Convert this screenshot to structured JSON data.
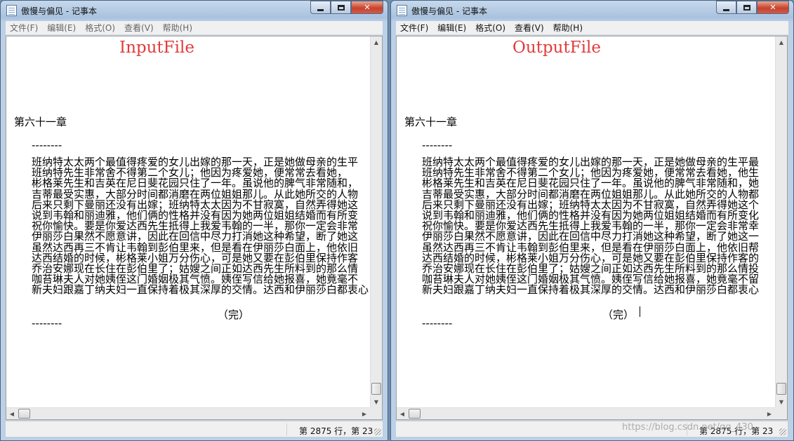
{
  "windows": {
    "left": {
      "title": "傲慢与偏见 - 记事本",
      "menu": [
        "文件(F)",
        "编辑(E)",
        "格式(O)",
        "查看(V)",
        "帮助(H)"
      ],
      "overlay_label": "InputFile",
      "content": {
        "chapter": "第六十一章",
        "rule_top": "--------",
        "paragraph": [
          "班纳特太太两个最值得疼爱的女儿出嫁的那一天，正是她做母亲的生平",
          "班纳特先生非常舍不得第二个女儿；他因为疼爱她，便常常去看她，",
          "彬格莱先生和吉英在尼日斐花园只住了一年。虽说他的脾气非常随和，",
          "吉蒂最受实惠，大部分时间都消磨在两位姐姐那儿。从此她所交的人物",
          "后来只剩下曼丽还没有出嫁；班纳特太太因为不甘寂寞，自然弄得她这",
          "说到韦翰和丽迪雅，他们俩的性格并没有因为她两位姐姐结婚而有所变",
          "祝你愉快。要是你爱达西先生抵得上我爱韦翰的一半，那你一定会非常",
          "伊丽莎白果然不愿意讲，因此在回信中尽力打消她这种希望，断了她这",
          "虽然达西再三不肯让韦翰到彭伯里来，但是看在伊丽莎白面上，他依旧",
          "达西结婚的时候，彬格莱小姐万分伤心，可是她又要在彭伯里保持作客",
          "乔治安娜现在长住在彭伯里了；姑嫂之间正如达西先生所料到的那么情",
          "咖苔琳夫人对她姨侄这门婚姻极其气愤。姨侄写信给她报喜，她竟毫不",
          "新夫妇跟嘉丁纳夫妇一直保持着极其深厚的交情。达西和伊丽莎白都衷心"
        ],
        "end_mark": "（完）",
        "rule_bottom": "--------"
      },
      "status": "第 2875 行，第 23"
    },
    "right": {
      "title": "傲慢与偏见 - 记事本",
      "menu": [
        "文件(F)",
        "编辑(E)",
        "格式(O)",
        "查看(V)",
        "帮助(H)"
      ],
      "overlay_label": "OutputFile",
      "content": {
        "chapter": "第六十一章",
        "rule_top": "--------",
        "paragraph": [
          "班纳特太太两个最值得疼爱的女儿出嫁的那一天，正是她做母亲的生平最",
          "班纳特先生非常舍不得第二个女儿；他因为疼爱她，便常常去看她，他生",
          "彬格莱先生和吉英在尼日斐花园只住了一年。虽说他的脾气非常随和，她",
          "吉蒂最受实惠，大部分时间都消磨在两位姐姐那儿。从此她所交的人物都",
          "后来只剩下曼丽还没有出嫁；班纳特太太因为不甘寂寞，自然弄得她这个",
          "说到韦翰和丽迪雅，他们俩的性格并没有因为她两位姐姐结婚而有所变化",
          "祝你愉快。要是你爱达西先生抵得上我爱韦翰的一半，那你一定会非常幸",
          "伊丽莎白果然不愿意讲，因此在回信中尽力打消她这种希望，断了她这一",
          "虽然达西再三不肯让韦翰到彭伯里来，但是看在伊丽莎白面上，他依旧帮",
          "达西结婚的时候，彬格莱小姐万分伤心，可是她又要在彭伯里保持作客的",
          "乔治安娜现在长住在彭伯里了；姑嫂之间正如达西先生所料到的那么情投",
          "咖苔琳夫人对她姨侄这门婚姻极其气愤。姨侄写信给她报喜，她竟毫不留",
          "新夫妇跟嘉丁纳夫妇一直保持着极其深厚的交情。达西和伊丽莎白都衷心"
        ],
        "end_mark": "（完）",
        "rule_bottom": "--------"
      },
      "status": "第 2875 行，第 23"
    }
  },
  "watermark": "https://blog.csdn.net/qq_430",
  "icons": {
    "app": "notepad-icon",
    "minimize": "minimize-icon",
    "maximize": "maximize-icon",
    "close": "close-icon",
    "scroll_up": "scroll-up-arrow-icon",
    "scroll_down": "scroll-down-arrow-icon",
    "scroll_left": "scroll-left-arrow-icon",
    "scroll_right": "scroll-right-arrow-icon",
    "resize_grip": "resize-grip-icon"
  },
  "colors": {
    "label_red": "#e23b3b",
    "title_gradient": "#a9c2de",
    "close_red": "#c8432a"
  }
}
